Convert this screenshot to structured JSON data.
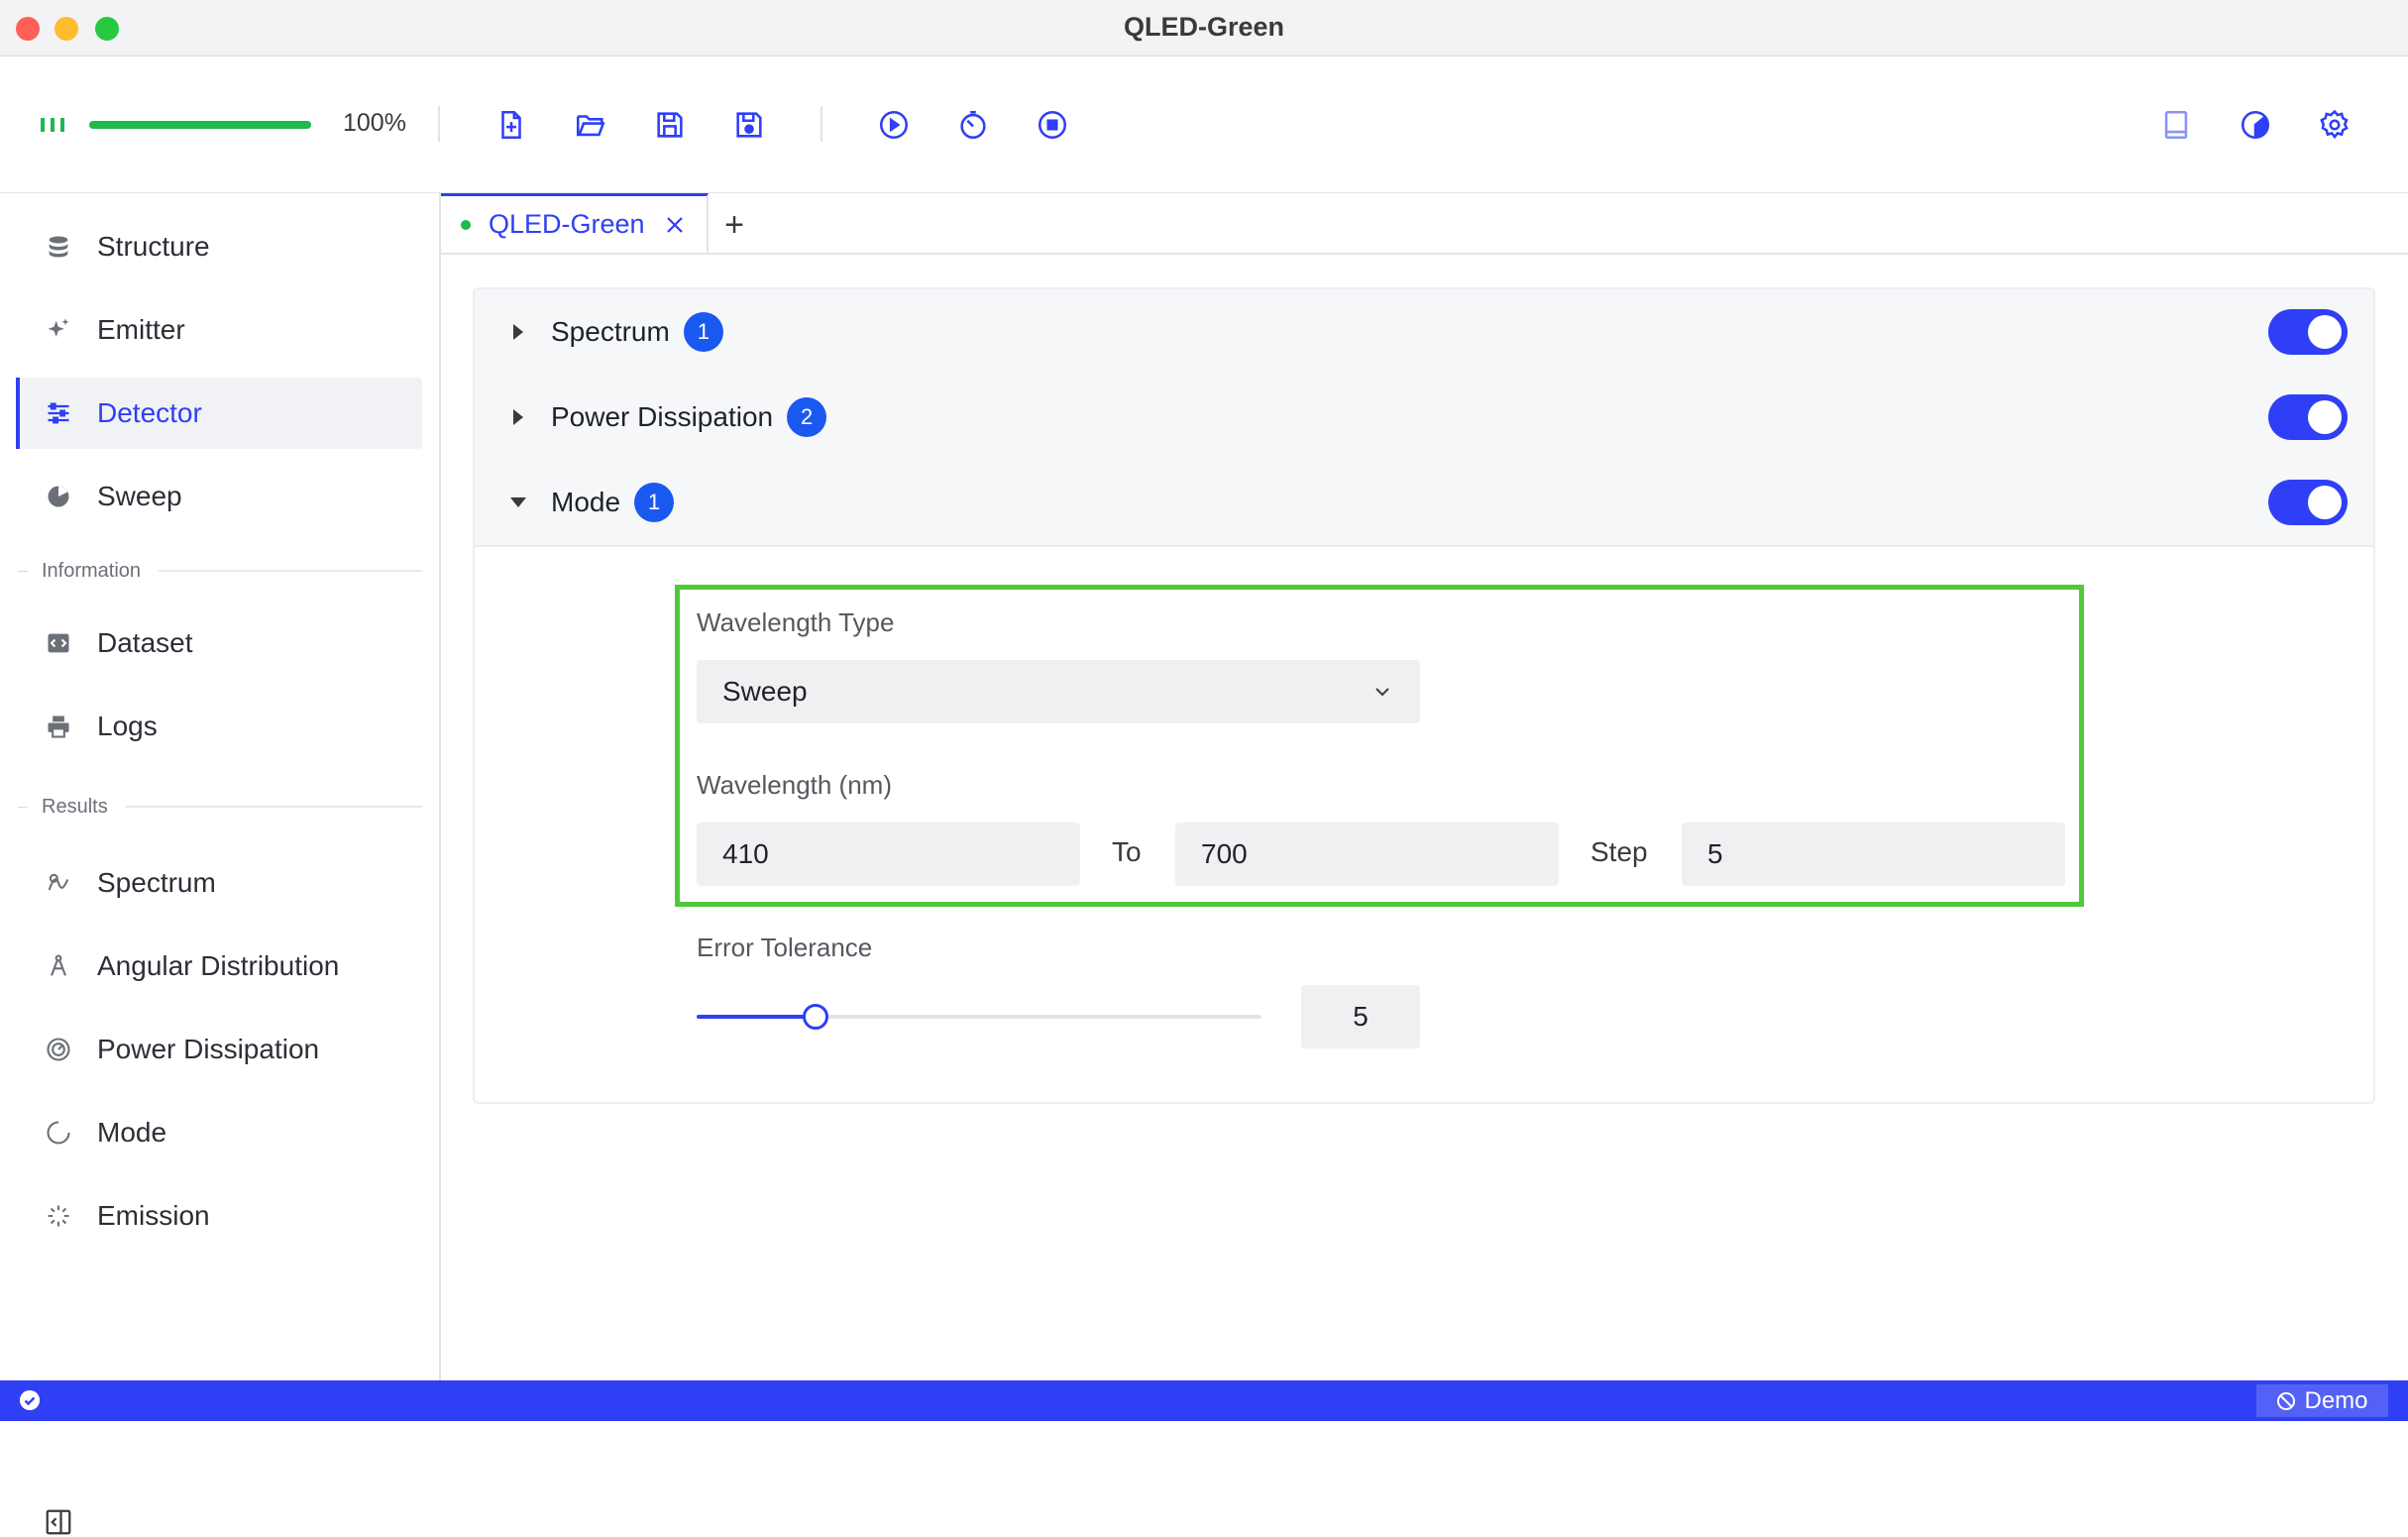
{
  "window": {
    "title": "QLED-Green"
  },
  "toolbar": {
    "progress_value": 1.0,
    "progress_text": "100%",
    "icons": [
      "new-file-icon",
      "open-folder-icon",
      "save-icon",
      "save-as-icon",
      "run-icon",
      "timer-icon",
      "stop-icon",
      "book-icon",
      "theme-icon",
      "settings-icon"
    ]
  },
  "sidebar": {
    "items": [
      {
        "label": "Structure",
        "icon": "database-icon"
      },
      {
        "label": "Emitter",
        "icon": "sparkle-icon"
      },
      {
        "label": "Detector",
        "icon": "sliders-icon",
        "active": true
      },
      {
        "label": "Sweep",
        "icon": "pie-icon"
      }
    ],
    "section_information": "Information",
    "information_items": [
      {
        "label": "Dataset",
        "icon": "code-icon"
      },
      {
        "label": "Logs",
        "icon": "printer-icon"
      }
    ],
    "section_results": "Results",
    "result_items": [
      {
        "label": "Spectrum",
        "icon": "spectrum-icon"
      },
      {
        "label": "Angular Distribution",
        "icon": "compass-icon"
      },
      {
        "label": "Power Dissipation",
        "icon": "gauge-icon"
      },
      {
        "label": "Mode",
        "icon": "loading-circle-icon"
      },
      {
        "label": "Emission",
        "icon": "burst-icon"
      }
    ]
  },
  "tabs": {
    "active_label": "QLED-Green",
    "add_label": "+"
  },
  "sections": [
    {
      "title": "Spectrum",
      "badge": "1",
      "enabled": true,
      "expanded": false
    },
    {
      "title": "Power Dissipation",
      "badge": "2",
      "enabled": true,
      "expanded": false
    },
    {
      "title": "Mode",
      "badge": "1",
      "enabled": true,
      "expanded": true
    }
  ],
  "mode_form": {
    "wavelength_type_label": "Wavelength Type",
    "wavelength_type_value": "Sweep",
    "wavelength_label": "Wavelength (nm)",
    "from_value": "410",
    "to_label": "To",
    "to_value": "700",
    "step_label": "Step",
    "step_value": "5",
    "error_tolerance_label": "Error Tolerance",
    "error_tolerance_value": "5",
    "error_tolerance_fraction": 0.21
  },
  "statusbar": {
    "demo_label": "Demo"
  },
  "colors": {
    "accent": "#2f3ff5",
    "success": "#1fb84f",
    "highlight": "#4fc93a",
    "badge": "#1a59f0"
  }
}
